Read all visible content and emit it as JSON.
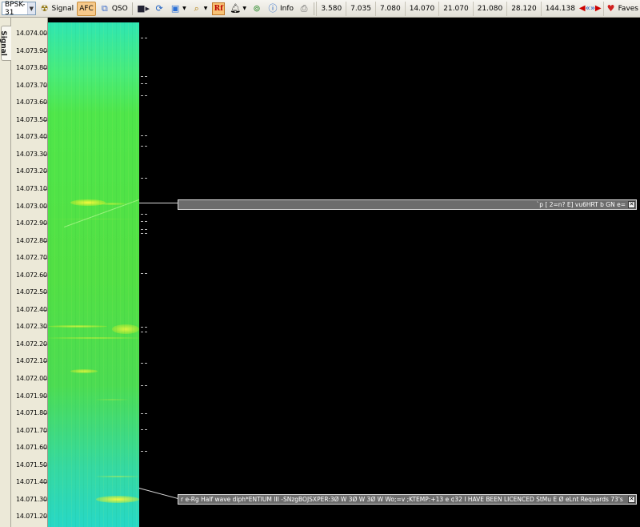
{
  "toolbar": {
    "mode_value": "BPSK-31",
    "signal_label": "Signal",
    "afc_label": "AFC",
    "qso_label": "QSO",
    "rf_label": "Rf",
    "info_label": "Info",
    "faves_label": "Faves",
    "bands": [
      "3.580",
      "7.035",
      "7.080",
      "14.070",
      "21.070",
      "21.080",
      "28.120",
      "144.138"
    ]
  },
  "sidebar": {
    "tab_label": "Signal"
  },
  "axis": {
    "labels": [
      "14.074.00",
      "14.073.90",
      "14.073.80",
      "14.073.70",
      "14.073.60",
      "14.073.50",
      "14.073.40",
      "14.073.30",
      "14.073.20",
      "14.073.10",
      "14.073.00",
      "14.072.90",
      "14.072.80",
      "14.072.70",
      "14.072.60",
      "14.072.50",
      "14.072.40",
      "14.072.30",
      "14.072.20",
      "14.072.10",
      "14.072.00",
      "14.071.90",
      "14.071.80",
      "14.071.70",
      "14.071.60",
      "14.071.50",
      "14.071.40",
      "14.071.30",
      "14.071.20"
    ]
  },
  "decodes": [
    {
      "text": "`p [ 2=n? E] vu6HRT b GN e=",
      "frequency": "14.073.00"
    },
    {
      "text": "r e-Rg Half wave diph*ENTIUM III -SNzgBOJSXPER:3Ø W 3Ø W 3Ø W Wo;=v ;KTEMP:+13 e ¢32 I HAVE BEEN LICENCED StMu E Ø eLnt Requards 73's",
      "frequency": "14.071.35"
    }
  ],
  "colors": {
    "waterfall_top": "#2fe6b2",
    "waterfall_mid": "#52e044",
    "waterfall_bottom": "#27d8c6",
    "signal_trace": "#f2f23a",
    "decode_box": "#6c6c6c"
  },
  "icons": [
    "radiation-icon",
    "qso-icon",
    "record-icon",
    "refresh-icon",
    "monitor-icon",
    "search-icon",
    "rf-icon",
    "bell-icon",
    "up-icon",
    "info-icon",
    "print-icon",
    "prev-icon",
    "rewind-icon",
    "forward-icon",
    "next-icon",
    "heart-icon"
  ]
}
